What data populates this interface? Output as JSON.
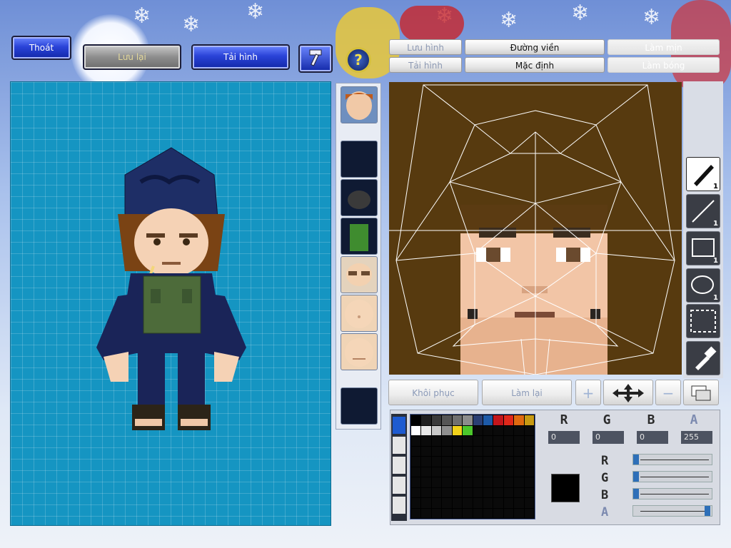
{
  "top_buttons": {
    "exit": "Thoát",
    "save": "Lưu lại",
    "reload": "Tải hình"
  },
  "tabs": {
    "save_image": "Lưu hình",
    "load_image": "Tải hình",
    "outline": "Đường viền",
    "default": "Mặc định",
    "smooth": "Làm mịn",
    "shade": "Làm bóng"
  },
  "help_icon": "?",
  "actions": {
    "restore": "Khôi phục",
    "redo": "Làm lại"
  },
  "tools": [
    {
      "name": "brush-tool",
      "count": "1"
    },
    {
      "name": "line-tool",
      "count": "1"
    },
    {
      "name": "rect-tool",
      "count": "1"
    },
    {
      "name": "ellipse-tool",
      "count": "1"
    },
    {
      "name": "select-tool",
      "count": ""
    },
    {
      "name": "eyedropper-tool",
      "count": ""
    }
  ],
  "portrait_count": "1",
  "color": {
    "labels": {
      "r": "R",
      "g": "G",
      "b": "B",
      "a": "A"
    },
    "r": "0",
    "g": "0",
    "b": "0",
    "a": "255",
    "current": "#000000",
    "slider_levels": {
      "r": 0,
      "g": 0,
      "b": 0,
      "a": 1
    }
  },
  "palette_colors": [
    "#000000",
    "#1f1f1f",
    "#3a3a3a",
    "#555555",
    "#707070",
    "#8c8c8c",
    "#2a3f74",
    "#1d5aa8",
    "#c3151b",
    "#e0281b",
    "#e06a10",
    "#c89a12",
    "#ffffff",
    "#e8e8e8",
    "#c8c8c8",
    "#8f8f8f"
  ],
  "palette_colors_row2": [
    "#f2d21b",
    "#4cc72c",
    "#0a0a0a"
  ]
}
